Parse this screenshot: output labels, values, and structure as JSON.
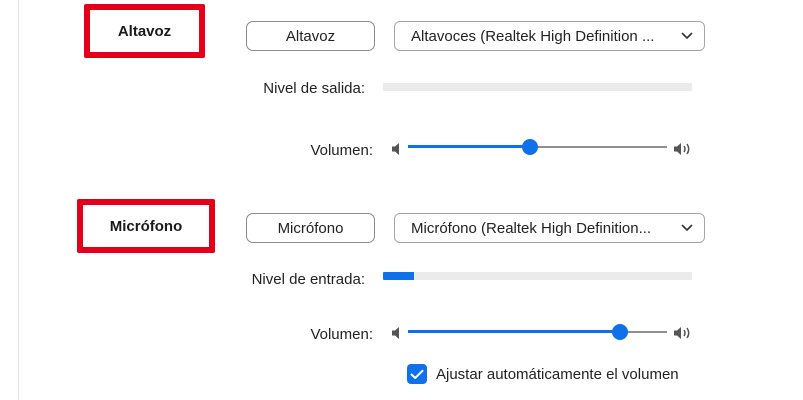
{
  "speaker": {
    "section_label": "Altavoz",
    "test_button": "Altavoz",
    "device_select": {
      "value": "Altavoces (Realtek High Definition ...",
      "icon": "chevron-down-icon"
    },
    "output_level": {
      "label": "Nivel de salida:",
      "level": 0
    },
    "volume": {
      "label": "Volumen:",
      "value_percent": 47,
      "low_icon": "volume-low-icon",
      "high_icon": "volume-high-icon"
    }
  },
  "microphone": {
    "section_label": "Micrófono",
    "test_button": "Micrófono",
    "device_select": {
      "value": "Micrófono (Realtek High Definition...",
      "icon": "chevron-down-icon"
    },
    "input_level": {
      "label": "Nivel de entrada:",
      "level": 0.1
    },
    "volume": {
      "label": "Volumen:",
      "value_percent": 82,
      "low_icon": "volume-low-icon",
      "high_icon": "volume-high-icon"
    },
    "auto_adjust": {
      "label": "Ajustar automáticamente el volumen",
      "checked": true
    }
  },
  "colors": {
    "accent": "#0e71eb",
    "highlight_box": "#e3001b",
    "track": "#8f8f8f",
    "level_bg": "#ebebeb"
  }
}
